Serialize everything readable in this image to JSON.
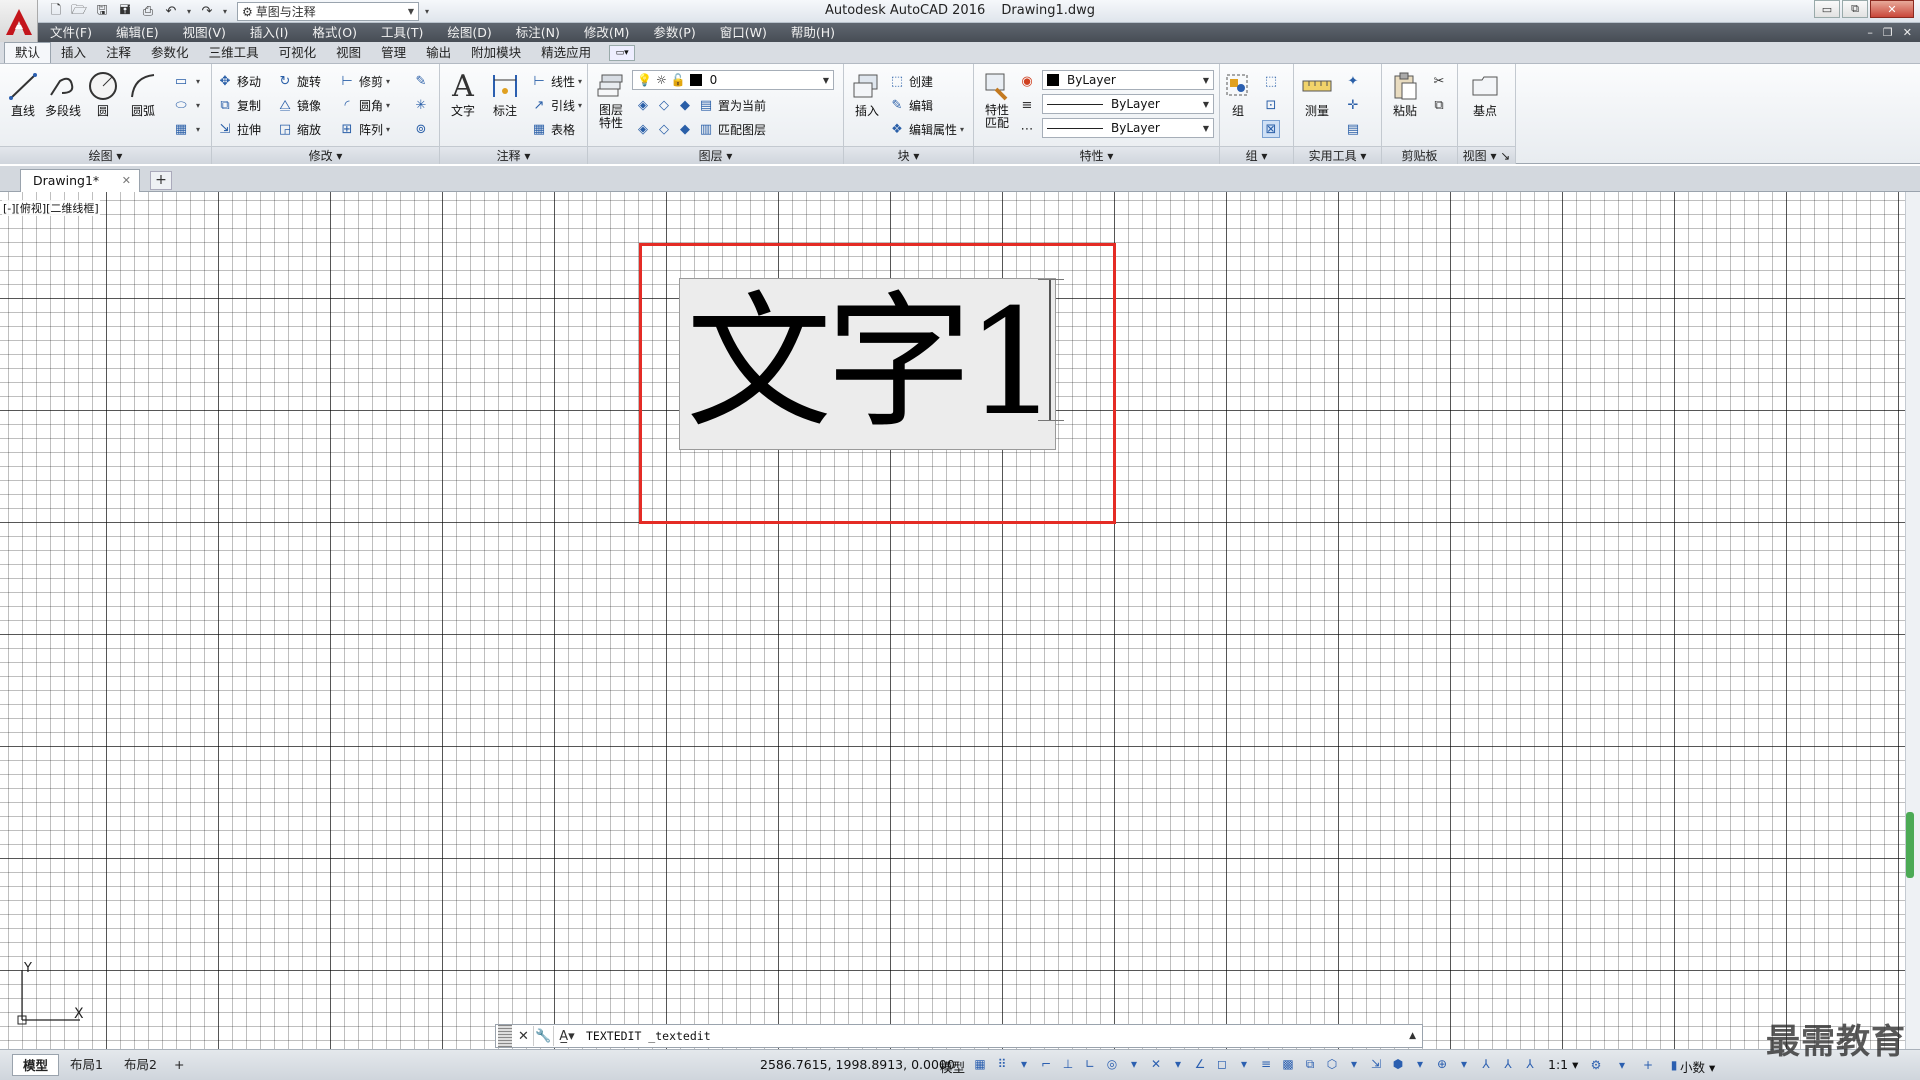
{
  "titlebar": {
    "app_title": "Autodesk AutoCAD 2016",
    "file_title": "Drawing1.dwg",
    "workspace": "草图与注释",
    "controls": {
      "minimize": "▭",
      "restore": "⧉",
      "close": "✕"
    }
  },
  "menubar": {
    "items": [
      "文件(F)",
      "编辑(E)",
      "视图(V)",
      "插入(I)",
      "格式(O)",
      "工具(T)",
      "绘图(D)",
      "标注(N)",
      "修改(M)",
      "参数(P)",
      "窗口(W)",
      "帮助(H)"
    ],
    "mdi": {
      "minimize": "–",
      "restore": "❐",
      "close": "✕"
    }
  },
  "ribbon_tabs": [
    "默认",
    "插入",
    "注释",
    "参数化",
    "三维工具",
    "可视化",
    "视图",
    "管理",
    "输出",
    "附加模块",
    "精选应用"
  ],
  "ribbon": {
    "draw": {
      "label": "绘图",
      "line": "直线",
      "polyline": "多段线",
      "circle": "圆",
      "arc": "圆弧"
    },
    "modify": {
      "label": "修改",
      "move": "移动",
      "rotate": "旋转",
      "trim": "修剪",
      "copy": "复制",
      "mirror": "镜像",
      "fillet": "圆角",
      "stretch": "拉伸",
      "scale": "缩放",
      "array": "阵列"
    },
    "annotation": {
      "label": "注释",
      "text": "文字",
      "dimension": "标注",
      "linear": "线性",
      "leader": "引线",
      "table": "表格"
    },
    "layers": {
      "label": "图层",
      "properties": "图层\n特性",
      "layer_value": "0",
      "set_current": "置为当前",
      "match_layer": "匹配图层"
    },
    "block": {
      "label": "块",
      "insert": "插入",
      "create": "创建",
      "edit": "编辑",
      "edit_attributes": "编辑属性"
    },
    "properties": {
      "label": "特性",
      "match": "特性\n匹配",
      "color": "ByLayer",
      "linetype": "ByLayer",
      "lineweight": "ByLayer"
    },
    "groups": {
      "label": "组",
      "group": "组"
    },
    "utilities": {
      "label": "实用工具",
      "measure": "测量"
    },
    "clipboard": {
      "label": "剪贴板",
      "paste": "粘贴"
    },
    "view": {
      "label": "视图",
      "base": "基点"
    }
  },
  "filetabs": {
    "doc": "Drawing1*",
    "close": "✕",
    "new": "+"
  },
  "canvas": {
    "view_label": "[-][俯视][二维线框]",
    "mtext": "文字1",
    "ucs_y": "Y",
    "ucs_x": "X"
  },
  "cmdline": {
    "text": "TEXTEDIT _textedit"
  },
  "statusbar": {
    "layouts": [
      "模型",
      "布局1",
      "布局2"
    ],
    "add_layout": "+",
    "coords": "2586.7615, 1998.8913, 0.0000",
    "model": "模型",
    "scale": "1:1",
    "units": "小数"
  },
  "watermark": "最需教育",
  "colors": {
    "highlight_box": "#e42b25",
    "editor_bg": "#ececec",
    "menubar": "#50565e",
    "accent": "#2b5fb0"
  }
}
